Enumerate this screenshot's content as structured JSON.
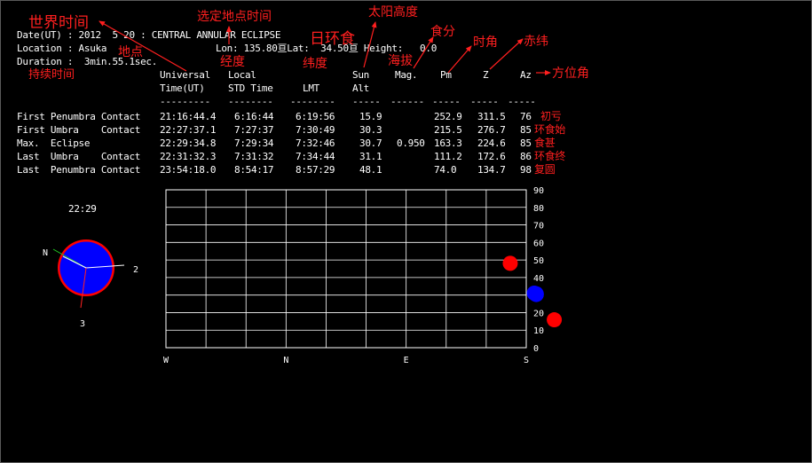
{
  "header": {
    "date_line": "Date(UT) : 2012  5 20 : CENTRAL ANNULAR ECLIPSE",
    "location_line": "Location : Asuka",
    "lonlat_line": "Lon: 135.80亘Lat:  34.50亘 Height:   0.0",
    "duration_line": "Duration :  3min.55.1sec."
  },
  "columns": {
    "row1": [
      "Universal",
      "Local",
      "",
      "Sun",
      "",
      "",
      "",
      ""
    ],
    "row2": [
      "Time(UT)",
      "STD Time",
      "LMT",
      "Alt",
      "Mag.",
      "Pm",
      "Z",
      "Az"
    ],
    "sep": [
      "---------",
      "--------",
      "--------",
      "-----",
      "------",
      "-----",
      "-----",
      "-----"
    ]
  },
  "events": [
    {
      "name": "First Penumbra Contact",
      "ut": "21:16:44.4",
      "std": "6:16:44",
      "lmt": "6:19:56",
      "alt": "15.9",
      "mag": "",
      "pm": "252.9",
      "z": "311.5",
      "az": "76",
      "note": "初亏"
    },
    {
      "name": "First Umbra    Contact",
      "ut": "22:27:37.1",
      "std": "7:27:37",
      "lmt": "7:30:49",
      "alt": "30.3",
      "mag": "",
      "pm": "215.5",
      "z": "276.7",
      "az": "85",
      "note": "环食始"
    },
    {
      "name": "Max.  Eclipse",
      "ut": "22:29:34.8",
      "std": "7:29:34",
      "lmt": "7:32:46",
      "alt": "30.7",
      "mag": "0.950",
      "pm": "163.3",
      "z": "224.6",
      "az": "85",
      "note": "食甚"
    },
    {
      "name": "Last  Umbra    Contact",
      "ut": "22:31:32.3",
      "std": "7:31:32",
      "lmt": "7:34:44",
      "alt": "31.1",
      "mag": "",
      "pm": "111.2",
      "z": "172.6",
      "az": "86",
      "note": "环食终"
    },
    {
      "name": "Last  Penumbra Contact",
      "ut": "23:54:18.0",
      "std": "8:54:17",
      "lmt": "8:57:29",
      "alt": "48.1",
      "mag": "",
      "pm": "74.0",
      "z": "134.7",
      "az": "98",
      "note": "复圆"
    }
  ],
  "annotations": {
    "world_time": "世界时间",
    "location": "地点",
    "duration": "持续时间",
    "local_time": "选定地点时间",
    "longitude": "经度",
    "latitude": "纬度",
    "annular": "日环食",
    "sun_alt": "太阳高度",
    "elevation": "海拔",
    "magnitude": "食分",
    "hour_angle": "时角",
    "declination": "赤纬",
    "azimuth": "方位角"
  },
  "disc": {
    "time": "22:29",
    "label_n": "N",
    "label_2": "2",
    "label_3": "3",
    "sun_color": "#ff0000",
    "moon_color": "#0000ff"
  },
  "chart_data": {
    "type": "scatter",
    "ylim": [
      0,
      90
    ],
    "yticks": [
      "0",
      "10",
      "20",
      "30",
      "40",
      "50",
      "60",
      "70",
      "80",
      "90"
    ],
    "xticks": [
      "W",
      "N",
      "E",
      "S"
    ],
    "xlim_azimuth": [
      270,
      90
    ],
    "points": [
      {
        "az": 76,
        "alt": 15.9,
        "color": "#ff0000"
      },
      {
        "az": 85,
        "alt": 30.3,
        "color": "#0000ff"
      },
      {
        "az": 85,
        "alt": 30.7,
        "color": "#0000ff"
      },
      {
        "az": 86,
        "alt": 31.1,
        "color": "#0000ff"
      },
      {
        "az": 98,
        "alt": 48.1,
        "color": "#ff0000"
      }
    ]
  }
}
